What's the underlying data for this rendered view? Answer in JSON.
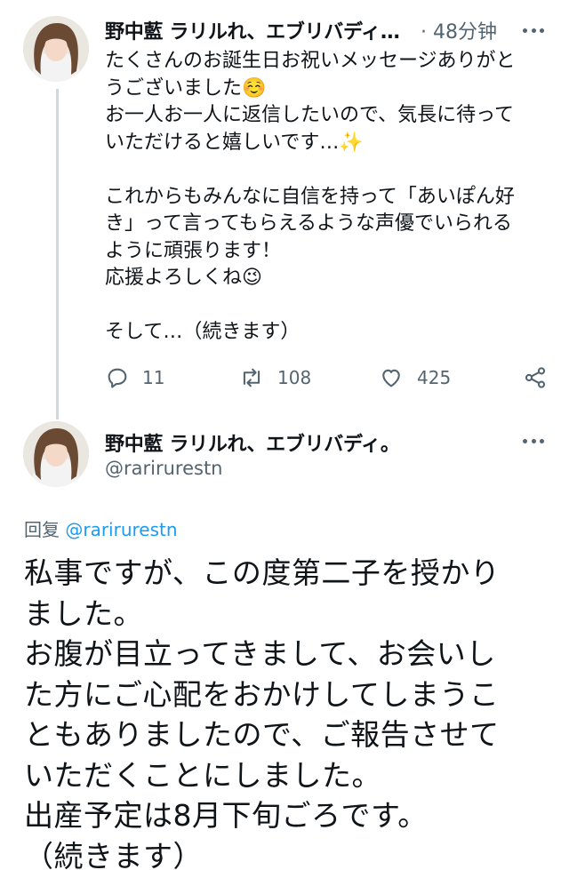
{
  "tweet1": {
    "author_name": "野中藍 ラリルれ、エブリバディ…",
    "separator": "·",
    "time": "48分钟",
    "text": "たくさんのお誕生日お祝いメッセージありがと\nうございました☺️\nお一人お一人に返信したいので、気長に待って\nいただけると嬉しいです…✨\n\nこれからもみんなに自信を持って「あいぽん好\nき」って言ってもらえるような声優でいられる\nように頑張ります！\n応援よろしくね😉\n\nそして…（続きます）",
    "actions": {
      "reply_count": "11",
      "retweet_count": "108",
      "like_count": "425"
    }
  },
  "tweet2": {
    "author_name": "野中藍 ラリルれ、エブリバディ。",
    "handle": "@rarirurestn",
    "reply_prefix": "回复",
    "reply_to": "@rarirurestn",
    "text": "私事ですが、この度第二子を授かり\nました。\nお腹が目立ってきまして、お会いし\nた方にご心配をおかけしてしまうこ\nともありましたので、ご報告させて\nいただくことにしました。\n出産予定は8月下旬ごろです。\n（続きます）"
  },
  "icons": [
    "reply-icon",
    "retweet-icon",
    "like-icon",
    "share-icon",
    "more-icon",
    "avatar"
  ],
  "colors": {
    "text": "#0f1419",
    "secondary": "#536471",
    "link": "#1d9bf0",
    "thread_line": "#cfd9de"
  }
}
